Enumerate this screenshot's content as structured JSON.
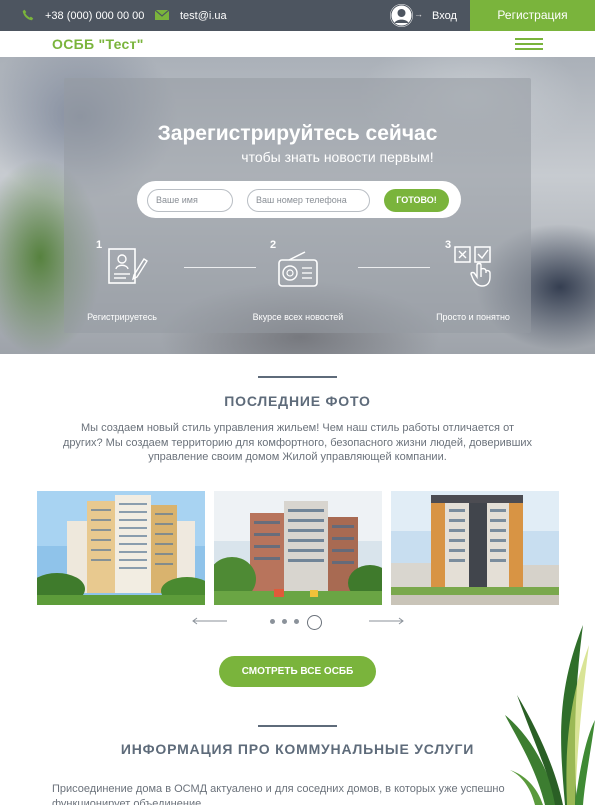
{
  "topbar": {
    "phone": "+38 (000) 000 00 00",
    "email": "test@i.ua",
    "login": "Вход",
    "register": "Регистрация"
  },
  "nav": {
    "brand": "ОСББ \"Тест\""
  },
  "hero": {
    "title": "Зарегистрируйтесь сейчас",
    "subtitle": "чтобы знать новости первым!",
    "name_placeholder": "Ваше имя",
    "phone_placeholder": "Ваш номер телефона",
    "submit": "ГОТОВО!",
    "steps": [
      {
        "num": "1",
        "label": "Регистрируетесь",
        "icon": "form-document-icon"
      },
      {
        "num": "2",
        "label": "Вкурсе всех новостей",
        "icon": "radio-icon"
      },
      {
        "num": "3",
        "label": "Просто и понятно",
        "icon": "checkbox-hand-icon"
      }
    ]
  },
  "photos": {
    "title": "ПОСЛЕДНИЕ ФОТО",
    "text": "Мы создаем новый стиль управления жильем! Чем наш стиль работы отличается от других? Мы создаем территорию для комфортного, безопасного жизни людей, доверивших управление своим домом Жилой управляющей компании.",
    "items": [
      "building-photo-1",
      "building-photo-2",
      "building-photo-3"
    ],
    "all_button": "СМОТРЕТЬ ВСЕ ОСББ"
  },
  "services": {
    "title": "ИНФОРМАЦИЯ ПРО КОММУНАЛЬНЫЕ УСЛУГИ",
    "text": "Присоединение дома в ОСМД актуалено и для соседних домов, в которых уже успешно функционирует объединение."
  },
  "colors": {
    "accent": "#7ab43c",
    "topbar": "#4d5560",
    "heading": "#5e6b7a"
  }
}
